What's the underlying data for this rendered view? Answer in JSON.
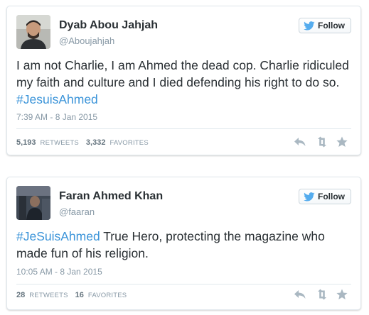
{
  "tweets": [
    {
      "name": "Dyab Abou Jahjah",
      "handle": "@Aboujahjah",
      "follow_label": "Follow",
      "text": "I am not Charlie, I am Ahmed the dead cop. Charlie ridiculed my faith and culture and I died defending his right to do so. ",
      "hashtag_text": "#JesuisAhmed",
      "timestamp": "7:39 AM - 8 Jan 2015",
      "retweets": "5,193",
      "retweets_label": "RETWEETS",
      "favorites": "3,332",
      "favorites_label": "FAVORITES"
    },
    {
      "name": "Faran Ahmed Khan",
      "handle": "@faaran",
      "follow_label": "Follow",
      "hashtag_text": "#JeSuisAhmed",
      "text": " True Hero, protecting the magazine who made fun of his religion.",
      "timestamp": "10:05 AM - 8 Jan 2015",
      "retweets": "28",
      "retweets_label": "RETWEETS",
      "favorites": "16",
      "favorites_label": "FAVORITES"
    }
  ],
  "icons": {
    "follow": "twitter-bird-icon",
    "reply": "reply-icon",
    "retweet": "retweet-icon",
    "favorite": "star-icon"
  },
  "colors": {
    "link": "#3b94d9",
    "bird": "#55acee",
    "muted": "#8899a6",
    "action_icons": "#aab8c2"
  }
}
